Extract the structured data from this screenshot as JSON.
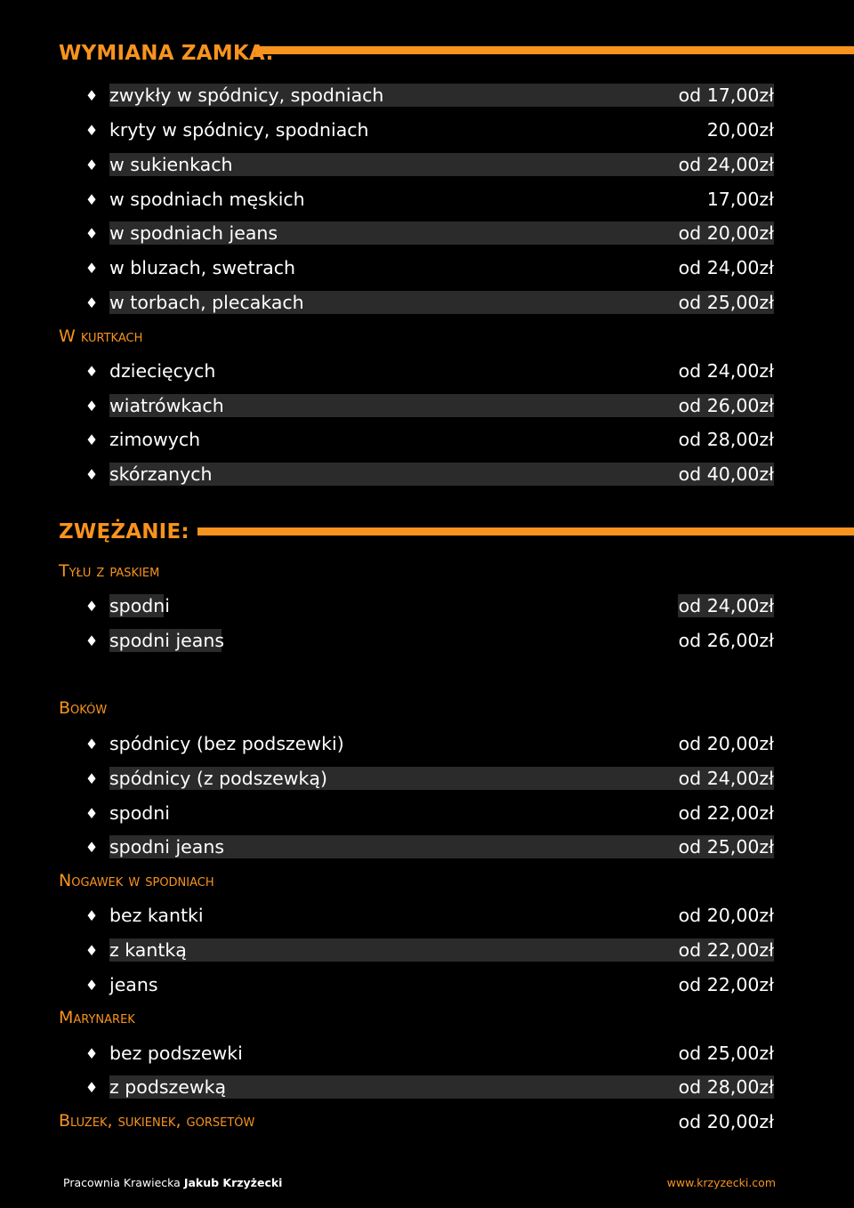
{
  "colors": {
    "accent": "#f7931e",
    "background": "#000000",
    "row_shade": "#2b2b2b",
    "text": "#ffffff"
  },
  "bullet_icon": "diamond-icon",
  "section1": {
    "title": "WYMIANA ZAMKA:",
    "items": [
      {
        "name": "zwykły w spódnicy, spodniach",
        "price": "od 17,00zł"
      },
      {
        "name": "kryty w spódnicy, spodniach",
        "price": "20,00zł"
      },
      {
        "name": "w sukienkach",
        "price": "od 24,00zł"
      },
      {
        "name": "w spodniach męskich",
        "price": "17,00zł"
      },
      {
        "name": "w spodniach jeans",
        "price": "od 20,00zł"
      },
      {
        "name": "w bluzach, swetrach",
        "price": "od 24,00zł"
      },
      {
        "name": "w torbach, plecakach",
        "price": "od 25,00zł"
      }
    ],
    "sub_kurtki": {
      "title": "W kurtkach",
      "items": [
        {
          "name": "dziecięcych",
          "price": "od 24,00zł"
        },
        {
          "name": "wiatrówkach",
          "price": "od 26,00zł"
        },
        {
          "name": "zimowych",
          "price": "od 28,00zł"
        },
        {
          "name": "skórzanych",
          "price": "od 40,00zł"
        }
      ]
    }
  },
  "section2": {
    "title": "ZWĘŻANIE:",
    "sub_tylu": {
      "title": "Tyłu z paskiem",
      "items": [
        {
          "name": "spodni",
          "price": "od 24,00zł"
        },
        {
          "name": "spodni jeans",
          "price": "od 26,00zł"
        }
      ]
    },
    "sub_bokow": {
      "title": "Boków",
      "items": [
        {
          "name": "spódnicy (bez podszewki)",
          "price": "od 20,00zł"
        },
        {
          "name": "spódnicy (z podszewką)",
          "price": "od 24,00zł"
        },
        {
          "name": "spodni",
          "price": "od 22,00zł"
        },
        {
          "name": "spodni jeans",
          "price": "od 25,00zł"
        }
      ]
    },
    "sub_nogawek": {
      "title": "Nogawek w spodniach",
      "items": [
        {
          "name": "bez kantki",
          "price": "od 20,00zł"
        },
        {
          "name": "z kantką",
          "price": "od 22,00zł"
        },
        {
          "name": "jeans",
          "price": "od 22,00zł"
        }
      ]
    },
    "sub_marynarek": {
      "title": "Marynarek",
      "items": [
        {
          "name": "bez podszewki",
          "price": "od 25,00zł"
        },
        {
          "name": "z podszewką",
          "price": "od 28,00zł"
        }
      ]
    },
    "sub_bluzek": {
      "title": "Bluzek, sukienek, gorsetów",
      "price": "od 20,00zł"
    }
  },
  "footer": {
    "left_prefix": "Pracownia Krawiecka",
    "left_name": "Jakub Krzyżecki",
    "url": "www.krzyzecki.com"
  }
}
